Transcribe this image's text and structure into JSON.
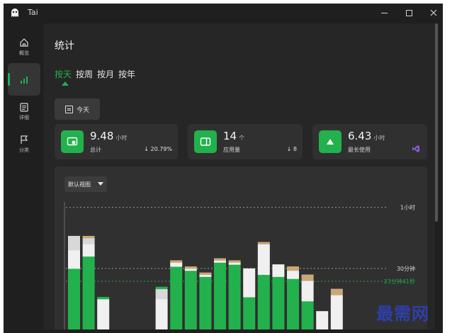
{
  "window": {
    "title": "Tai"
  },
  "nav": {
    "items": [
      {
        "label": "概览",
        "icon": "home-icon"
      },
      {
        "label": "",
        "icon": "bar-chart-icon"
      },
      {
        "label": "详细",
        "icon": "document-icon"
      },
      {
        "label": "分类",
        "icon": "flag-icon"
      }
    ]
  },
  "page": {
    "title": "统计"
  },
  "tabs": [
    {
      "label": "按天",
      "active": true
    },
    {
      "label": "按周",
      "active": false
    },
    {
      "label": "按月",
      "active": false
    },
    {
      "label": "按年",
      "active": false
    }
  ],
  "today_button": {
    "label": "今天"
  },
  "cards": [
    {
      "value": "9.48",
      "unit": "小时",
      "label": "总计",
      "delta": "20.79%",
      "delta_dir": "down"
    },
    {
      "value": "14",
      "unit": "个",
      "label": "应用量",
      "delta": "8",
      "delta_dir": "down"
    },
    {
      "value": "6.43",
      "unit": "小时",
      "label": "最长使用"
    }
  ],
  "view_select": {
    "value": "默认视图"
  },
  "chart_data": {
    "type": "bar",
    "stacked": true,
    "reference_lines": [
      {
        "label": "1小时",
        "minutes": 60,
        "color": "#9a9a9a"
      },
      {
        "label": "30分钟",
        "minutes": 30,
        "color": "#9a9a9a"
      },
      {
        "label": "23分钟41秒",
        "minutes": 23.68,
        "color": "#22b14c"
      }
    ],
    "colors": {
      "green": "#22b14c",
      "white": "#f0f0f0",
      "gray": "#d8d8d8",
      "tan": "#c9a878"
    },
    "bars": [
      {
        "segments": [
          {
            "c": "green",
            "v": 30
          },
          {
            "c": "white",
            "v": 9
          },
          {
            "c": "gray",
            "v": 7
          }
        ]
      },
      {
        "segments": [
          {
            "c": "green",
            "v": 36
          },
          {
            "c": "white",
            "v": 6
          },
          {
            "c": "gray",
            "v": 3
          },
          {
            "c": "tan",
            "v": 1
          }
        ]
      },
      {
        "segments": [
          {
            "c": "white",
            "v": 15
          },
          {
            "c": "green",
            "v": 1
          }
        ]
      },
      {
        "segments": []
      },
      {
        "segments": []
      },
      {
        "segments": []
      },
      {
        "segments": [
          {
            "c": "white",
            "v": 15
          },
          {
            "c": "gray",
            "v": 5
          },
          {
            "c": "green",
            "v": 1
          }
        ]
      },
      {
        "segments": [
          {
            "c": "green",
            "v": 31
          },
          {
            "c": "white",
            "v": 2
          },
          {
            "c": "tan",
            "v": 1
          }
        ]
      },
      {
        "segments": [
          {
            "c": "green",
            "v": 29
          },
          {
            "c": "white",
            "v": 1
          },
          {
            "c": "tan",
            "v": 1
          }
        ]
      },
      {
        "segments": [
          {
            "c": "green",
            "v": 26
          },
          {
            "c": "white",
            "v": 1
          },
          {
            "c": "tan",
            "v": 1
          }
        ]
      },
      {
        "segments": [
          {
            "c": "green",
            "v": 33
          },
          {
            "c": "white",
            "v": 1
          },
          {
            "c": "tan",
            "v": 1
          }
        ]
      },
      {
        "segments": [
          {
            "c": "green",
            "v": 32
          },
          {
            "c": "white",
            "v": 1
          },
          {
            "c": "tan",
            "v": 1
          }
        ]
      },
      {
        "segments": [
          {
            "c": "green",
            "v": 16
          },
          {
            "c": "white",
            "v": 14
          }
        ]
      },
      {
        "segments": [
          {
            "c": "green",
            "v": 27
          },
          {
            "c": "white",
            "v": 15
          },
          {
            "c": "tan",
            "v": 1
          }
        ]
      },
      {
        "segments": [
          {
            "c": "green",
            "v": 26
          },
          {
            "c": "white",
            "v": 6
          }
        ]
      },
      {
        "segments": [
          {
            "c": "green",
            "v": 25
          },
          {
            "c": "white",
            "v": 4
          },
          {
            "c": "tan",
            "v": 2
          }
        ]
      },
      {
        "segments": [
          {
            "c": "green",
            "v": 14
          },
          {
            "c": "white",
            "v": 10
          },
          {
            "c": "tan",
            "v": 3
          }
        ]
      },
      {
        "segments": [
          {
            "c": "white",
            "v": 9
          }
        ]
      },
      {
        "segments": [
          {
            "c": "white",
            "v": 17
          },
          {
            "c": "tan",
            "v": 3
          }
        ]
      }
    ],
    "y_max_minutes": 62
  }
}
